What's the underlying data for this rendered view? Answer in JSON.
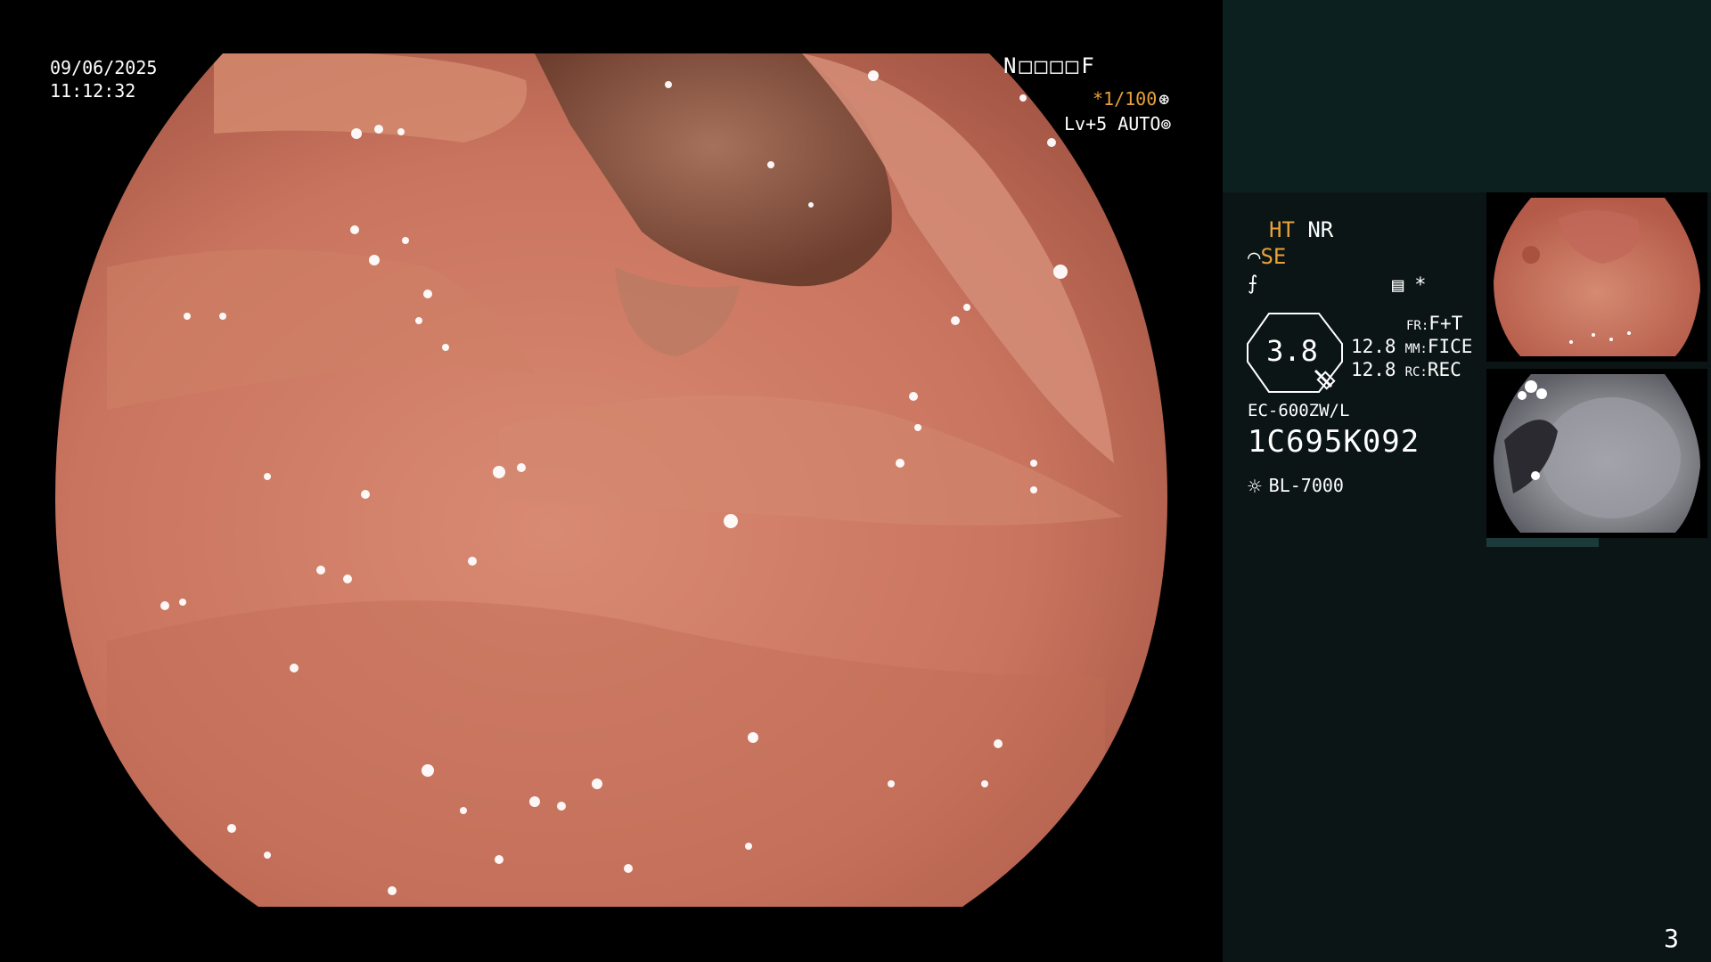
{
  "overlay": {
    "date": "09/06/2025",
    "time": "11:12:32",
    "patient_code": "N□□□□F",
    "shutter": "*1/100",
    "shutter_icon": "aperture-icon",
    "iris": "Lv+5 AUTO",
    "iris_icon": "iris-icon"
  },
  "panel": {
    "enhance_ht": "HT",
    "enhance_nr": "NR",
    "structure_se": "SE",
    "structure_icon": "structure-enhance-icon",
    "filter_icon": "filter-icon",
    "memory_icon": "memory-card-icon",
    "star": "*",
    "zoom": "3.8",
    "values": [
      "12.8",
      "12.8"
    ],
    "fr_label": "FR:",
    "fr_value": "F+T",
    "mm_label": "MM:",
    "mm_value": "FICE",
    "rc_label": "RC:",
    "rc_value": "REC",
    "scope_model": "EC-600ZW/L",
    "scope_serial": "1C695K092",
    "light_icon": "light-source-icon",
    "light_source": "BL-7000"
  },
  "colors": {
    "accent_orange": "#e8a23a",
    "panel_bg": "#0b1515",
    "panel_top": "#0c2020",
    "tissue": "#c9745f"
  },
  "page_number": "3"
}
